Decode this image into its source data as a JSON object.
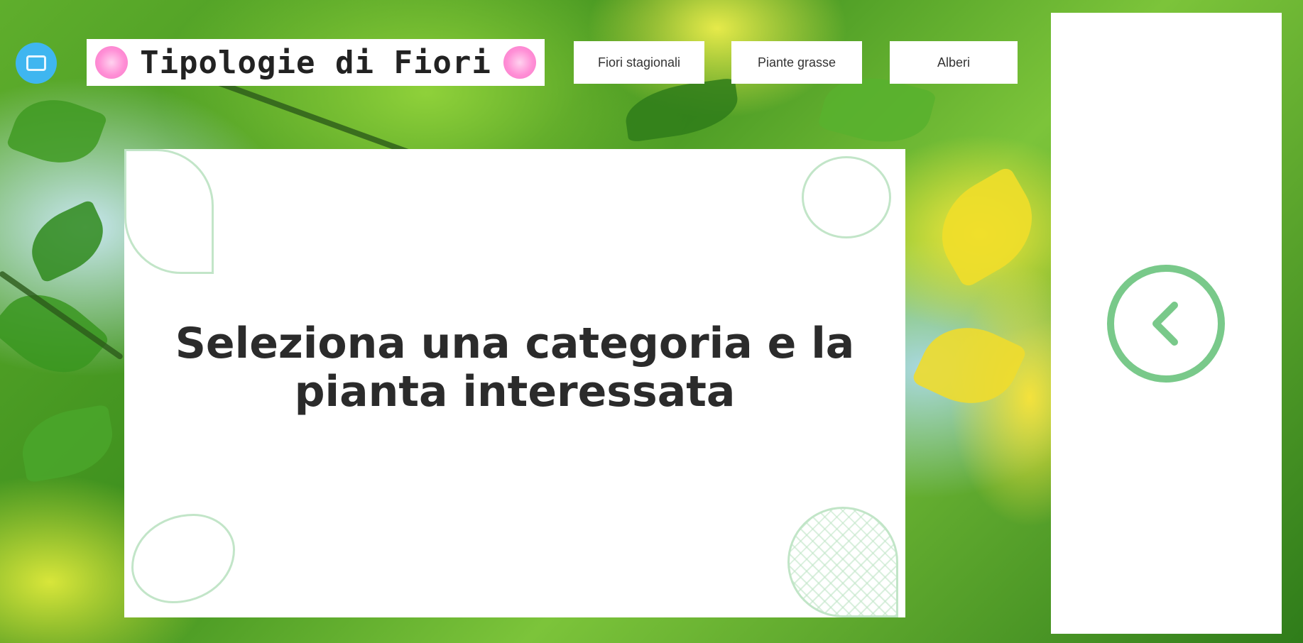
{
  "header": {
    "title": "Tipologie di Fiori",
    "nav": [
      {
        "label": "Fiori stagionali"
      },
      {
        "label": "Piante grasse"
      },
      {
        "label": "Alberi"
      }
    ]
  },
  "main": {
    "message": "Seleziona una categoria e la pianta interessata"
  },
  "side_panel": {
    "back_icon": "chevron-left-circle"
  },
  "colors": {
    "accent_green": "#79c98a",
    "logo_blue": "#3fb6f0",
    "flower_pink": "#ff8fd6"
  }
}
